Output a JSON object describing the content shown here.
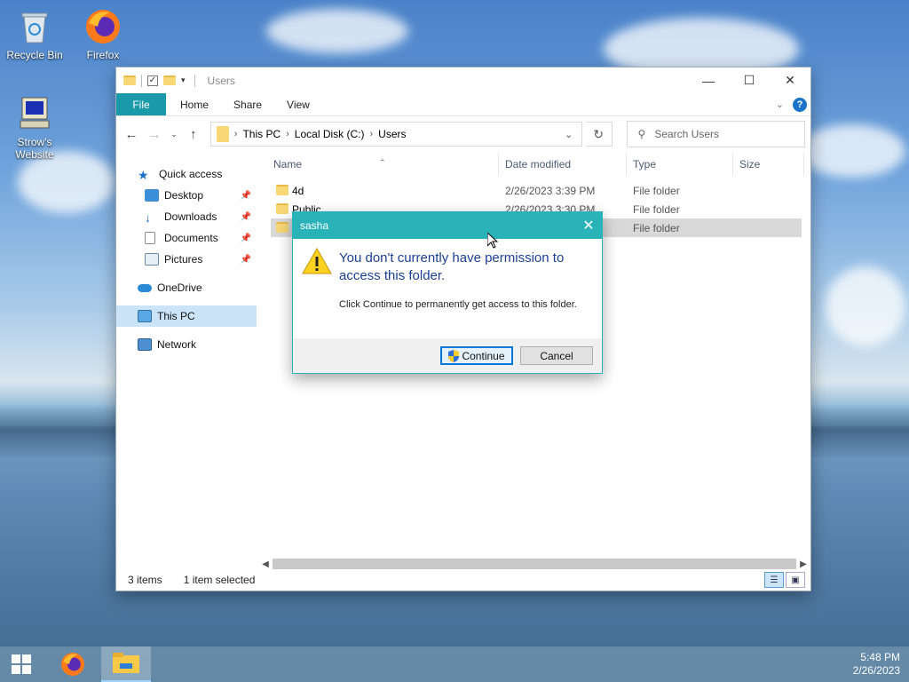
{
  "desktop": {
    "icons": [
      {
        "label": "Recycle Bin",
        "icon": "recycle-bin-icon"
      },
      {
        "label": "Firefox",
        "icon": "firefox-icon"
      },
      {
        "label": "Strow's Website",
        "icon": "computer-shortcut-icon"
      }
    ]
  },
  "window": {
    "title": "Users",
    "controls": {
      "minimize": "—",
      "maximize": "☐",
      "close": "✕"
    },
    "ribbon_tabs": [
      "File",
      "Home",
      "Share",
      "View"
    ],
    "address": {
      "crumbs": [
        "This PC",
        "Local Disk (C:)",
        "Users"
      ]
    },
    "search_placeholder": "Search Users",
    "nav_pane": {
      "quick_access": "Quick access",
      "pinned": [
        "Desktop",
        "Downloads",
        "Documents",
        "Pictures"
      ],
      "onedrive": "OneDrive",
      "this_pc": "This PC",
      "network": "Network"
    },
    "columns": [
      "Name",
      "Date modified",
      "Type",
      "Size"
    ],
    "files": [
      {
        "name": "4d",
        "date": "2/26/2023 3:39 PM",
        "type": "File folder"
      },
      {
        "name": "Public",
        "date": "2/26/2023 3:30 PM",
        "type": "File folder"
      },
      {
        "name": "sasha",
        "date": "",
        "type": "File folder"
      }
    ],
    "status": {
      "count": "3 items",
      "selected": "1 item selected"
    }
  },
  "dialog": {
    "title": "sasha",
    "message": "You don't currently have permission to access this folder.",
    "detail": "Click Continue to permanently get access to this folder.",
    "continue_label": "Continue",
    "cancel_label": "Cancel",
    "accent": "#2ab2b9"
  },
  "taskbar": {
    "time": "5:48 PM",
    "date": "2/26/2023"
  }
}
